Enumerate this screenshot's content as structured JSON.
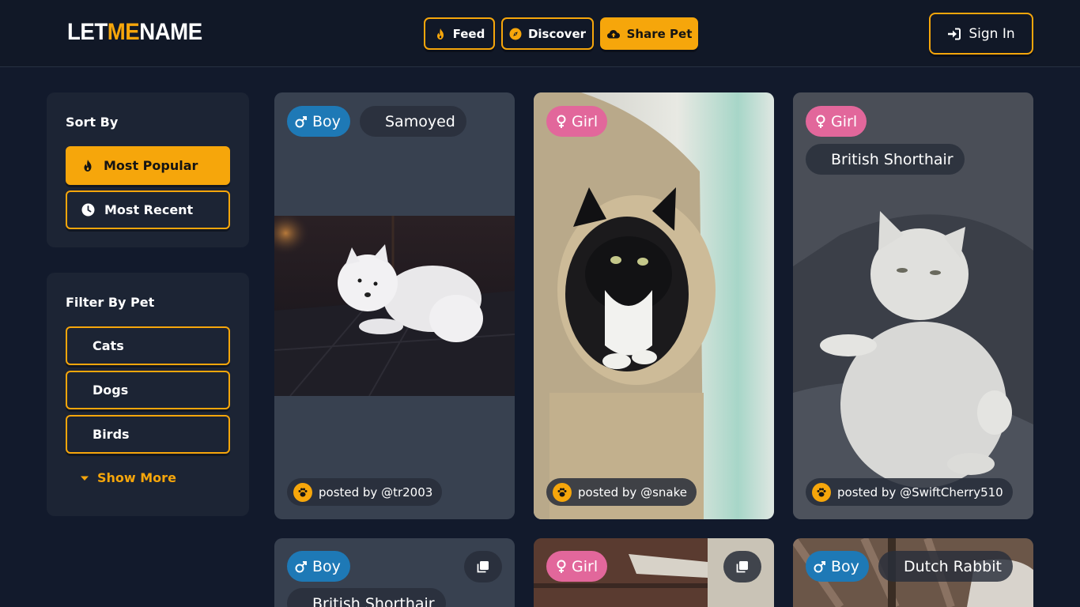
{
  "header": {
    "logo": {
      "part1": "LET",
      "part2": "ME",
      "part3": "NAME"
    },
    "nav": {
      "feed_label": "Feed",
      "discover_label": "Discover",
      "share_label": "Share Pet"
    },
    "signin_label": "Sign In"
  },
  "sidebar": {
    "sort_title": "Sort By",
    "sort_options": [
      {
        "label": "Most Popular",
        "active": true,
        "icon": "fire-icon"
      },
      {
        "label": "Most Recent",
        "active": false,
        "icon": "clock-icon"
      }
    ],
    "filter_title": "Filter By Pet",
    "filter_options": [
      {
        "label": "Cats"
      },
      {
        "label": "Dogs"
      },
      {
        "label": "Birds"
      }
    ],
    "show_more_label": "Show More"
  },
  "feed": {
    "cards": [
      {
        "gender": "Boy",
        "breed": "Samoyed",
        "poster": "posted by @tr2003"
      },
      {
        "gender": "Girl",
        "breed": "",
        "poster": "posted by @snake"
      },
      {
        "gender": "Girl",
        "breed": "British Shorthair",
        "poster": "posted by @SwiftCherry510"
      },
      {
        "gender": "Boy",
        "breed": "British Shorthair",
        "poster": ""
      },
      {
        "gender": "Girl",
        "breed": "",
        "poster": ""
      },
      {
        "gender": "Boy",
        "breed": "Dutch Rabbit",
        "poster": ""
      }
    ]
  },
  "colors": {
    "accent": "#f6a60b",
    "background": "#121a2c",
    "panel": "#1c2434",
    "boy_tag": "#1e79b6",
    "girl_tag": "#e2679b"
  }
}
